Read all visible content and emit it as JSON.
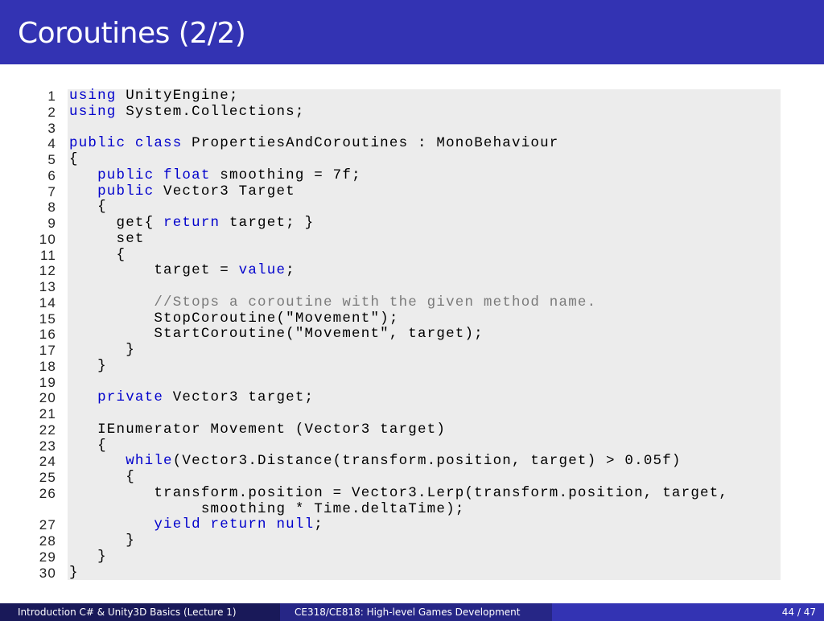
{
  "slide": {
    "title": "Coroutines (2/2)"
  },
  "code": {
    "lines": [
      {
        "n": "1",
        "text": "using UnityEngine;"
      },
      {
        "n": "2",
        "text": "using System.Collections;"
      },
      {
        "n": "3",
        "text": ""
      },
      {
        "n": "4",
        "text": "public class PropertiesAndCoroutines : MonoBehaviour"
      },
      {
        "n": "5",
        "text": "{"
      },
      {
        "n": "6",
        "text": "   public float smoothing = 7f;"
      },
      {
        "n": "7",
        "text": "   public Vector3 Target"
      },
      {
        "n": "8",
        "text": "   {"
      },
      {
        "n": "9",
        "text": "     get{ return target; }"
      },
      {
        "n": "10",
        "text": "     set"
      },
      {
        "n": "11",
        "text": "     {"
      },
      {
        "n": "12",
        "text": "         target = value;"
      },
      {
        "n": "13",
        "text": ""
      },
      {
        "n": "14",
        "text": "         //Stops a coroutine with the given method name."
      },
      {
        "n": "15",
        "text": "         StopCoroutine(\"Movement\");"
      },
      {
        "n": "16",
        "text": "         StartCoroutine(\"Movement\", target);"
      },
      {
        "n": "17",
        "text": "      }"
      },
      {
        "n": "18",
        "text": "   }"
      },
      {
        "n": "19",
        "text": ""
      },
      {
        "n": "20",
        "text": "   private Vector3 target;"
      },
      {
        "n": "21",
        "text": ""
      },
      {
        "n": "22",
        "text": "   IEnumerator Movement (Vector3 target)"
      },
      {
        "n": "23",
        "text": "   {"
      },
      {
        "n": "24",
        "text": "      while(Vector3.Distance(transform.position, target) > 0.05f)"
      },
      {
        "n": "25",
        "text": "      {"
      },
      {
        "n": "26",
        "text": "         transform.position = Vector3.Lerp(transform.position, target,\n              smoothing * Time.deltaTime);"
      },
      {
        "n": "27",
        "text": "         yield return null;"
      },
      {
        "n": "28",
        "text": "      }"
      },
      {
        "n": "29",
        "text": "   }"
      },
      {
        "n": "30",
        "text": "}"
      }
    ]
  },
  "footer": {
    "left": "Introduction C# & Unity3D Basics (Lecture 1)",
    "center": "CE318/CE818: High-level Games Development",
    "right": "44 / 47"
  },
  "colors": {
    "title_bar": "#3333b3",
    "keyword": "#0000cc",
    "comment": "#7a7a7a",
    "code_bg": "#ececec"
  }
}
